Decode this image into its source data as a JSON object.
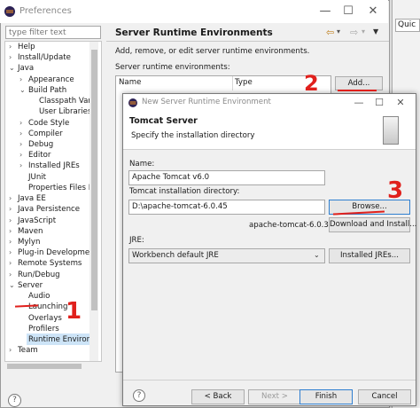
{
  "outer": {
    "title": "Preferences",
    "filter_placeholder": "type filter text",
    "tree": [
      {
        "label": "Help",
        "level": 0,
        "expander": "closed"
      },
      {
        "label": "Install/Update",
        "level": 0,
        "expander": "closed"
      },
      {
        "label": "Java",
        "level": 0,
        "expander": "open"
      },
      {
        "label": "Appearance",
        "level": 1,
        "expander": "closed"
      },
      {
        "label": "Build Path",
        "level": 1,
        "expander": "open"
      },
      {
        "label": "Classpath Varia",
        "level": 2,
        "expander": ""
      },
      {
        "label": "User Libraries",
        "level": 2,
        "expander": ""
      },
      {
        "label": "Code Style",
        "level": 1,
        "expander": "closed"
      },
      {
        "label": "Compiler",
        "level": 1,
        "expander": "closed"
      },
      {
        "label": "Debug",
        "level": 1,
        "expander": "closed"
      },
      {
        "label": "Editor",
        "level": 1,
        "expander": "closed"
      },
      {
        "label": "Installed JREs",
        "level": 1,
        "expander": "closed"
      },
      {
        "label": "JUnit",
        "level": 1,
        "expander": ""
      },
      {
        "label": "Properties Files Ed",
        "level": 1,
        "expander": ""
      },
      {
        "label": "Java EE",
        "level": 0,
        "expander": "closed"
      },
      {
        "label": "Java Persistence",
        "level": 0,
        "expander": "closed"
      },
      {
        "label": "JavaScript",
        "level": 0,
        "expander": "closed"
      },
      {
        "label": "Maven",
        "level": 0,
        "expander": "closed"
      },
      {
        "label": "Mylyn",
        "level": 0,
        "expander": "closed"
      },
      {
        "label": "Plug-in Development",
        "level": 0,
        "expander": "closed"
      },
      {
        "label": "Remote Systems",
        "level": 0,
        "expander": "closed"
      },
      {
        "label": "Run/Debug",
        "level": 0,
        "expander": "closed"
      },
      {
        "label": "Server",
        "level": 0,
        "expander": "open"
      },
      {
        "label": "Audio",
        "level": 1,
        "expander": ""
      },
      {
        "label": "Launching",
        "level": 1,
        "expander": ""
      },
      {
        "label": "Overlays",
        "level": 1,
        "expander": ""
      },
      {
        "label": "Profilers",
        "level": 1,
        "expander": ""
      },
      {
        "label": "Runtime Environm",
        "level": 1,
        "expander": "",
        "selected": true
      },
      {
        "label": "Team",
        "level": 0,
        "expander": "closed"
      }
    ],
    "page_title": "Server Runtime Environments",
    "page_desc": "Add, remove, or edit server runtime environments.",
    "env_label": "Server runtime environments:",
    "columns": [
      "Name",
      "Type"
    ],
    "add_label": "Add...",
    "help_glyph": "?"
  },
  "background_window": {
    "input_text": "Quic"
  },
  "dialog": {
    "title": "New Server Runtime Environment",
    "heading": "Tomcat Server",
    "subtitle": "Specify the installation directory",
    "name_label": "Name:",
    "name_value": "Apache Tomcat v6.0",
    "dir_label": "Tomcat installation directory:",
    "dir_value": "D:\\apache-tomcat-6.0.45",
    "browse_label": "Browse...",
    "version_text": "apache-tomcat-6.0.37",
    "download_label": "Download and Install...",
    "jre_label": "JRE:",
    "jre_value": "Workbench default JRE",
    "installed_jres_label": "Installed JREs...",
    "back_label": "< Back",
    "next_label": "Next >",
    "finish_label": "Finish",
    "cancel_label": "Cancel",
    "help_glyph": "?"
  },
  "annotations": {
    "one": "1",
    "two": "2",
    "three": "3"
  },
  "icons": {
    "window_minimize": "minimize-icon",
    "window_maximize": "maximize-icon",
    "window_close": "close-icon",
    "nav_back": "back-arrow-icon",
    "nav_forward": "forward-arrow-icon",
    "view_menu": "view-menu-icon"
  },
  "colors": {
    "annotation_red": "#e0201c",
    "selection": "#cde4f7",
    "focus_border": "#2f7fd0"
  }
}
